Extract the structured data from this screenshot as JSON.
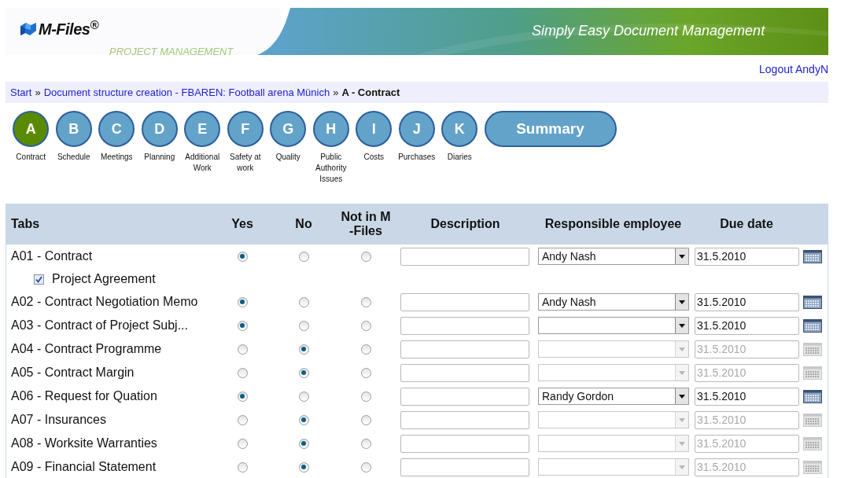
{
  "header": {
    "logo": "M-Files$^{®}$",
    "subtitle": "PROJECT MANAGEMENT",
    "tagline": "Simply Easy Document Management"
  },
  "user_link": "Logout AndyN",
  "breadcrumb": {
    "separator": "»",
    "items": [
      {
        "label": "Start",
        "current": false
      },
      {
        "label": "Document structure creation - FBAREN: Football arena Münich",
        "current": false
      },
      {
        "label": "A - Contract",
        "current": true
      }
    ]
  },
  "steps": [
    {
      "letter": "A",
      "label": "Contract",
      "selected": true
    },
    {
      "letter": "B",
      "label": "Schedule",
      "selected": false
    },
    {
      "letter": "C",
      "label": "Meetings",
      "selected": false
    },
    {
      "letter": "D",
      "label": "Planning",
      "selected": false
    },
    {
      "letter": "E",
      "label": "Additional Work",
      "selected": false
    },
    {
      "letter": "F",
      "label": "Safety at work",
      "selected": false
    },
    {
      "letter": "G",
      "label": "Quality",
      "selected": false
    },
    {
      "letter": "H",
      "label": "Public Authority Issues",
      "selected": false
    },
    {
      "letter": "I",
      "label": "Costs",
      "selected": false
    },
    {
      "letter": "J",
      "label": "Purchases",
      "selected": false
    },
    {
      "letter": "K",
      "label": "Diaries",
      "selected": false
    }
  ],
  "summary_button": "Summary",
  "table": {
    "columns": [
      "Tabs",
      "Yes",
      "No",
      "Not in M -Files",
      "Description",
      "Responsible employee",
      "Due date"
    ],
    "rows": [
      {
        "label": "A01 - Contract",
        "choices": [
          {
            "selected": true
          },
          {
            "selected": false
          },
          {
            "selected": false
          }
        ],
        "disabled": false,
        "employee": "Andy Nash",
        "due_date": "31.5.2010",
        "children": [
          {
            "label": "Project Agreement",
            "checked": true
          }
        ]
      },
      {
        "label": "A02 - Contract Negotiation Memo",
        "choices": [
          {
            "selected": true
          },
          {
            "selected": false
          },
          {
            "selected": false
          }
        ],
        "disabled": false,
        "employee": "Andy Nash",
        "due_date": "31.5.2010"
      },
      {
        "label": "A03 - Contract of Project Subj...",
        "choices": [
          {
            "selected": true
          },
          {
            "selected": false
          },
          {
            "selected": false
          }
        ],
        "disabled": false,
        "due_date": "31.5.2010"
      },
      {
        "label": "A04 - Contract Programme",
        "choices": [
          {
            "selected": false
          },
          {
            "selected": true
          },
          {
            "selected": false
          }
        ],
        "disabled": true,
        "due_date": "31.5.2010"
      },
      {
        "label": "A05 - Contract Margin",
        "choices": [
          {
            "selected": false
          },
          {
            "selected": true
          },
          {
            "selected": false
          }
        ],
        "disabled": true,
        "due_date": "31.5.2010"
      },
      {
        "label": "A06 - Request for Quation",
        "choices": [
          {
            "selected": true
          },
          {
            "selected": false
          },
          {
            "selected": false
          }
        ],
        "disabled": false,
        "employee": "Randy Gordon",
        "due_date": "31.5.2010"
      },
      {
        "label": "A07 - Insurances",
        "choices": [
          {
            "selected": false
          },
          {
            "selected": true
          },
          {
            "selected": false
          }
        ],
        "disabled": true,
        "due_date": "31.5.2010"
      },
      {
        "label": "A08 - Worksite Warranties",
        "choices": [
          {
            "selected": false
          },
          {
            "selected": true
          },
          {
            "selected": false
          }
        ],
        "disabled": true,
        "due_date": "31.5.2010"
      },
      {
        "label": "A09 - Financial Statement",
        "choices": [
          {
            "selected": false
          },
          {
            "selected": true
          },
          {
            "selected": false
          }
        ],
        "disabled": true,
        "due_date": "31.5.2010"
      }
    ]
  }
}
